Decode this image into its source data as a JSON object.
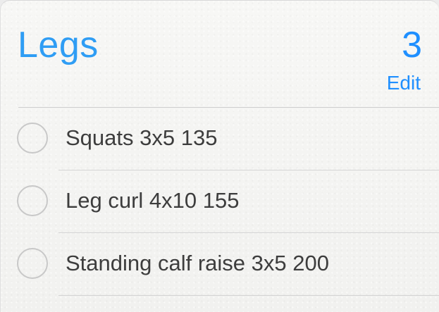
{
  "list": {
    "title": "Legs",
    "count": "3",
    "edit_label": "Edit",
    "items": [
      {
        "label": "Squats 3x5 135"
      },
      {
        "label": "Leg curl 4x10 155"
      },
      {
        "label": "Standing calf raise 3x5 200"
      }
    ]
  },
  "colors": {
    "accent": "#1f8fff",
    "title": "#2f9df4",
    "text": "#3d3d3d",
    "divider": "#d3d3d3"
  }
}
